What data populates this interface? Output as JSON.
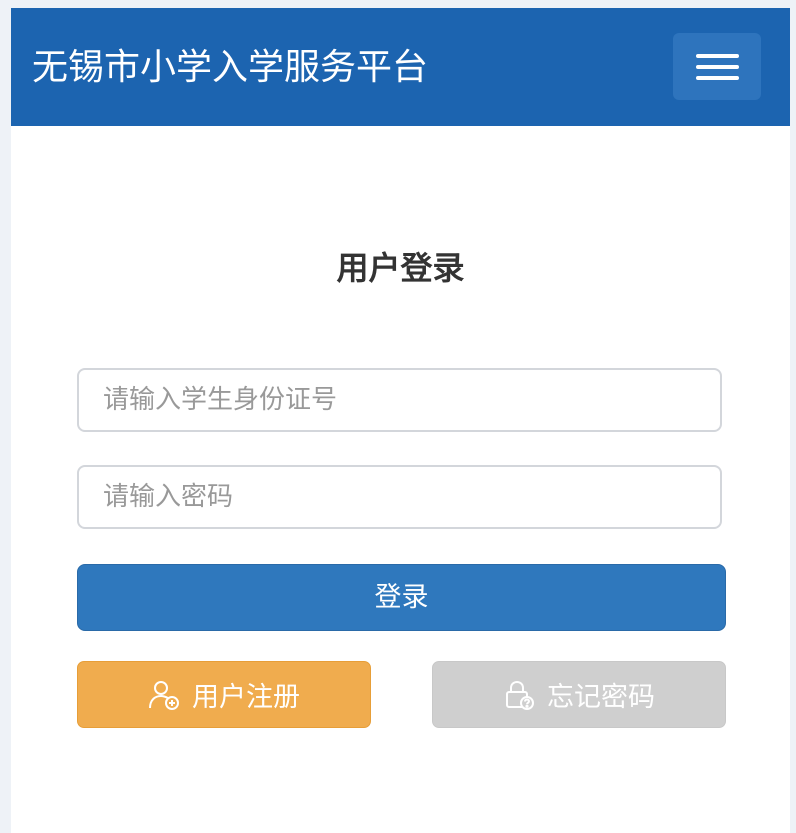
{
  "header": {
    "title": "无锡市小学入学服务平台",
    "menu_icon": "hamburger-icon"
  },
  "login": {
    "heading": "用户登录",
    "id_placeholder": "请输入学生身份证号",
    "password_placeholder": "请输入密码",
    "submit_label": "登录"
  },
  "actions": {
    "register_label": "用户注册",
    "register_icon": "user-add-icon",
    "forgot_label": "忘记密码",
    "forgot_icon": "lock-help-icon"
  },
  "colors": {
    "navbar": "#1c64b0",
    "primary": "#2f78bd",
    "warning": "#f0ac4e",
    "disabled": "#cfcfcf"
  }
}
